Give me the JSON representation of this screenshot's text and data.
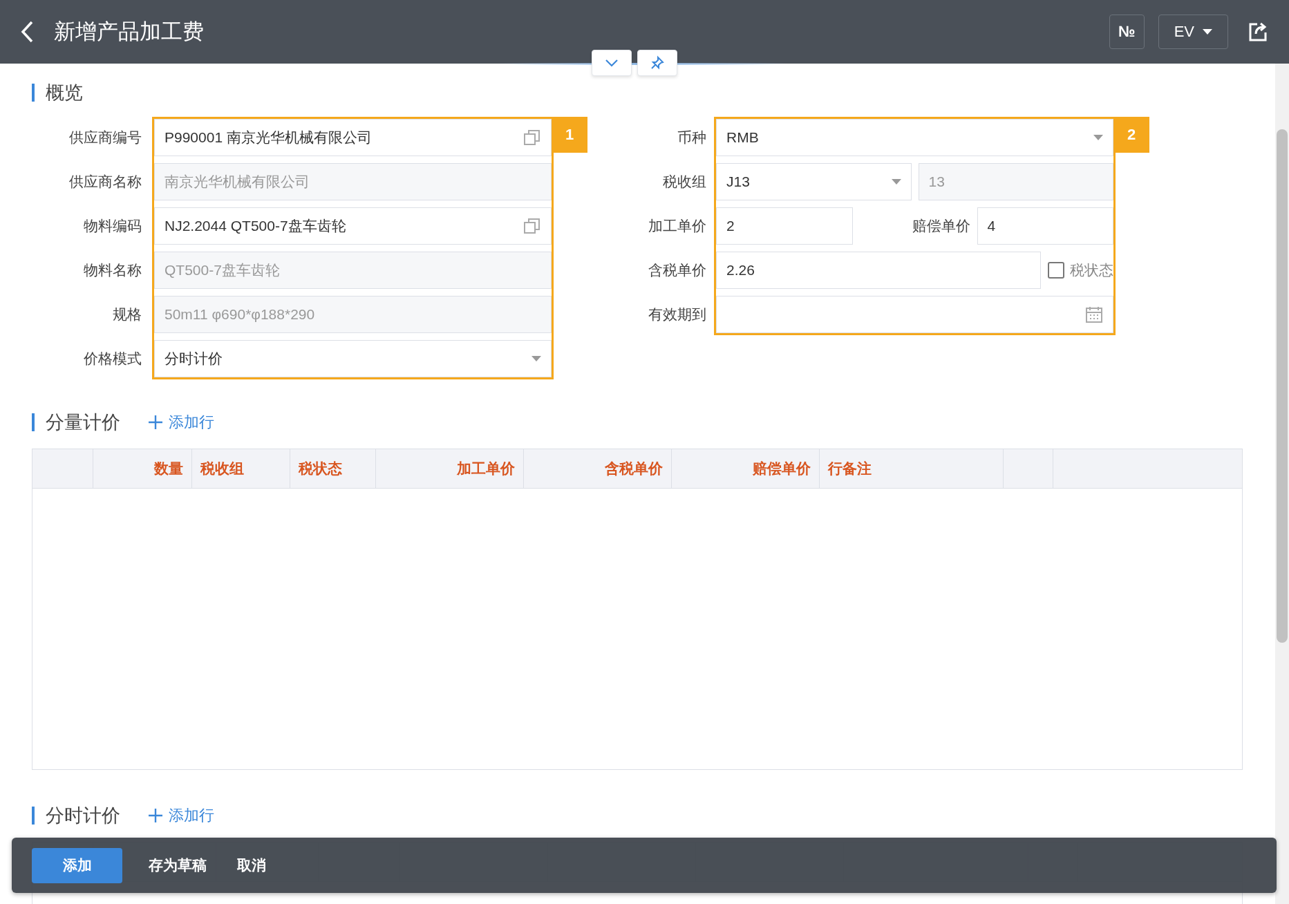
{
  "header": {
    "title": "新增产品加工费",
    "number_button": "№",
    "language": "EV"
  },
  "overview": {
    "title": "概览",
    "left": {
      "badge": "1",
      "rows": [
        {
          "label": "供应商编号",
          "value": "P990001 南京光华机械有限公司",
          "kind": "lookup"
        },
        {
          "label": "供应商名称",
          "value": "南京光华机械有限公司",
          "kind": "readonly"
        },
        {
          "label": "物料编码",
          "value": "NJ2.2044 QT500-7盘车齿轮",
          "kind": "lookup"
        },
        {
          "label": "物料名称",
          "value": "QT500-7盘车齿轮",
          "kind": "readonly"
        },
        {
          "label": "规格",
          "value": "50m11 φ690*φ188*290",
          "kind": "readonly"
        },
        {
          "label": "价格模式",
          "value": "分时计价",
          "kind": "select"
        }
      ]
    },
    "right": {
      "badge": "2",
      "rows": [
        {
          "label": "币种",
          "parts": [
            {
              "kind": "select",
              "value": "RMB"
            }
          ]
        },
        {
          "label": "税收组",
          "parts": [
            {
              "kind": "select",
              "value": "J13"
            },
            {
              "kind": "readonly",
              "value": "13"
            }
          ]
        },
        {
          "label": "加工单价",
          "parts": [
            {
              "kind": "input",
              "value": "2"
            },
            {
              "kind": "label",
              "value": "赔偿单价"
            },
            {
              "kind": "input",
              "value": "4"
            }
          ]
        },
        {
          "label": "含税单价",
          "parts": [
            {
              "kind": "input",
              "value": "2.26"
            },
            {
              "kind": "checkbox",
              "value": "税状态",
              "checked": false
            }
          ]
        },
        {
          "label": "有效期到",
          "parts": [
            {
              "kind": "date"
            }
          ]
        }
      ]
    }
  },
  "sections": [
    {
      "title": "分量计价",
      "add_row": "添加行",
      "columns": [
        "数量",
        "税收组",
        "税状态",
        "加工单价",
        "含税单价",
        "赔偿单价",
        "行备注"
      ]
    },
    {
      "title": "分时计价",
      "add_row": "添加行"
    }
  ],
  "actions": [
    {
      "label": "添加",
      "kind": "primary"
    },
    {
      "label": "存为草稿",
      "kind": "plain"
    },
    {
      "label": "取消",
      "kind": "plain"
    }
  ]
}
